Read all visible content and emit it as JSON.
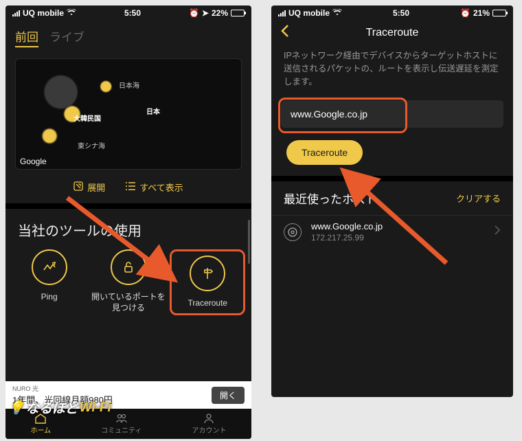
{
  "left": {
    "statusbar": {
      "carrier": "UQ mobile",
      "time": "5:50",
      "battery_pct": "22%"
    },
    "tabs": {
      "active": "前回",
      "inactive": "ライブ"
    },
    "map": {
      "labels": {
        "japan_sea": "日本海",
        "korea": "大韓民国",
        "japan": "日本",
        "east_china": "東シナ海"
      },
      "attribution": "Google"
    },
    "map_actions": {
      "expand": "展開",
      "show_all": "すべて表示"
    },
    "tools": {
      "title": "当社のツールの使用",
      "items": [
        {
          "label": "Ping"
        },
        {
          "label": "開いているポートを見つける"
        },
        {
          "label": "Traceroute"
        }
      ]
    },
    "ad": {
      "brand": "NURO 光",
      "text": "1年間、光回線月額980円",
      "cta": "開く"
    },
    "bottomnav": {
      "home": "ホーム",
      "community": "コミュニティ",
      "account": "アカウント"
    },
    "watermark": {
      "a": "なるほど",
      "b": "Wi-Fi"
    }
  },
  "right": {
    "statusbar": {
      "carrier": "UQ mobile",
      "time": "5:50",
      "battery_pct": "21%"
    },
    "header": {
      "title": "Traceroute"
    },
    "description": "IPネットワーク経由でデバイスからターゲットホストに送信されるパケットの、ルートを表示し伝送遅延を測定します。",
    "input_value": "www.Google.co.jp",
    "button": "Traceroute",
    "recent": {
      "title": "最近使ったホスト",
      "clear": "クリアする",
      "host": {
        "name": "www.Google.co.jp",
        "ip": "172.217.25.99"
      }
    }
  }
}
